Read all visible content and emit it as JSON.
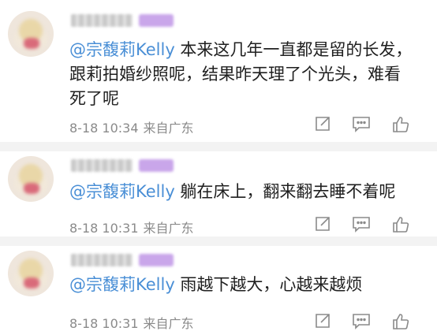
{
  "comments": [
    {
      "mention": "@宗馥莉Kelly",
      "text": " 本来这几年一直都是留的长发，跟莉拍婚纱照呢，结果昨天理了个光头，难看死了呢",
      "time": "8-18 10:34",
      "location": "来自广东"
    },
    {
      "mention": "@宗馥莉Kelly",
      "text": " 躺在床上，翻来翻去睡不着呢",
      "time": "8-18 10:31",
      "location": "来自广东"
    },
    {
      "mention": "@宗馥莉Kelly",
      "text": " 雨越下越大，心越来越烦",
      "time": "8-18 10:31",
      "location": "来自广东"
    }
  ],
  "icons": {
    "share": "share-icon",
    "comment": "comment-icon",
    "like": "like-icon"
  },
  "colors": {
    "mention": "#4a8fd6",
    "text": "#1f1f1f",
    "meta": "#8a8a8a",
    "icon": "#8a8a8a",
    "badge": "#c9a6ea"
  }
}
